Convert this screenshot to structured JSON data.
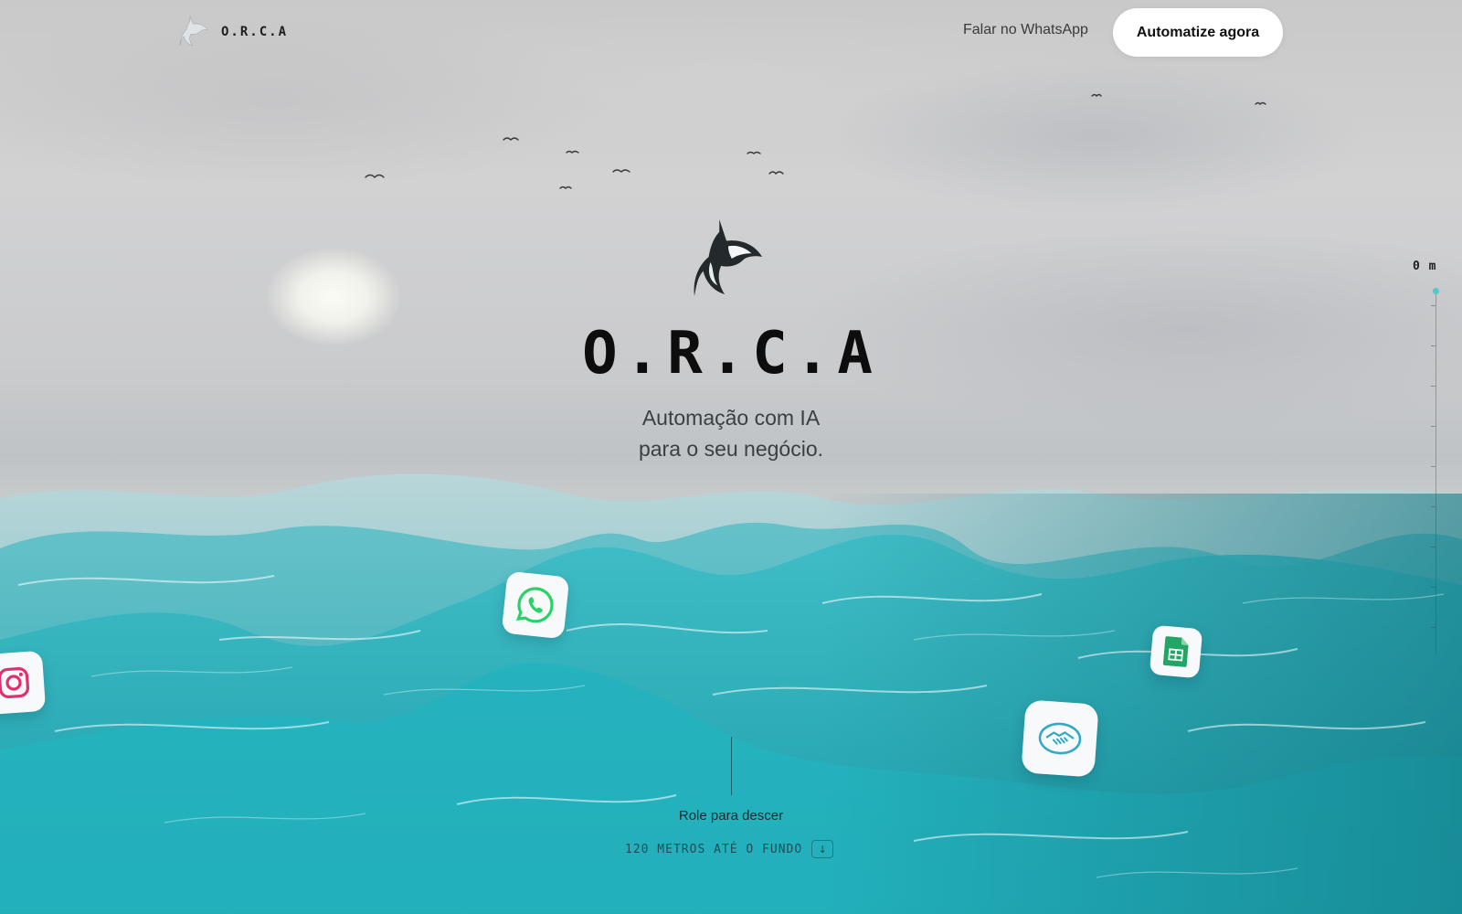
{
  "nav": {
    "brand": "O.R.C.A",
    "whatsapp_link": "Falar no WhatsApp",
    "cta_label": "Automatize agora"
  },
  "hero": {
    "title": "O.R.C.A",
    "subtitle_line1": "Automação com IA",
    "subtitle_line2": "para o seu negócio."
  },
  "scroll_cue": {
    "label": "Role para descer",
    "depth_note": "120 METROS ATÉ O FUNDO",
    "arrow": "↓"
  },
  "depth_gauge": {
    "readout": "0 m",
    "progress": 0
  },
  "floating_apps": [
    "whatsapp-icon",
    "instagram-icon",
    "google-sheets-icon",
    "handshake-icon"
  ],
  "colors": {
    "sea": "#25a9b6",
    "sky": "#cfcfd0",
    "title": "#0d0d0d",
    "whatsapp": "#25d366",
    "instagram": "#e1306c",
    "sheets": "#23a566",
    "deal": "#31a9c7"
  }
}
